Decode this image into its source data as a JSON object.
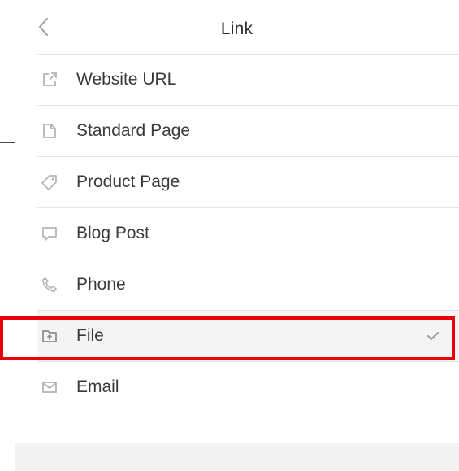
{
  "header": {
    "title": "Link"
  },
  "items": [
    {
      "label": "Website URL",
      "icon": "external-link-icon"
    },
    {
      "label": "Standard Page",
      "icon": "page-icon"
    },
    {
      "label": "Product Page",
      "icon": "tag-icon"
    },
    {
      "label": "Blog Post",
      "icon": "comment-icon"
    },
    {
      "label": "Phone",
      "icon": "phone-icon"
    },
    {
      "label": "File",
      "icon": "folder-upload-icon",
      "selected": true
    },
    {
      "label": "Email",
      "icon": "envelope-icon"
    }
  ],
  "colors": {
    "highlight": "#e8000b",
    "icon": "#b5b5b5",
    "selected_background": "#f4f4f4"
  }
}
